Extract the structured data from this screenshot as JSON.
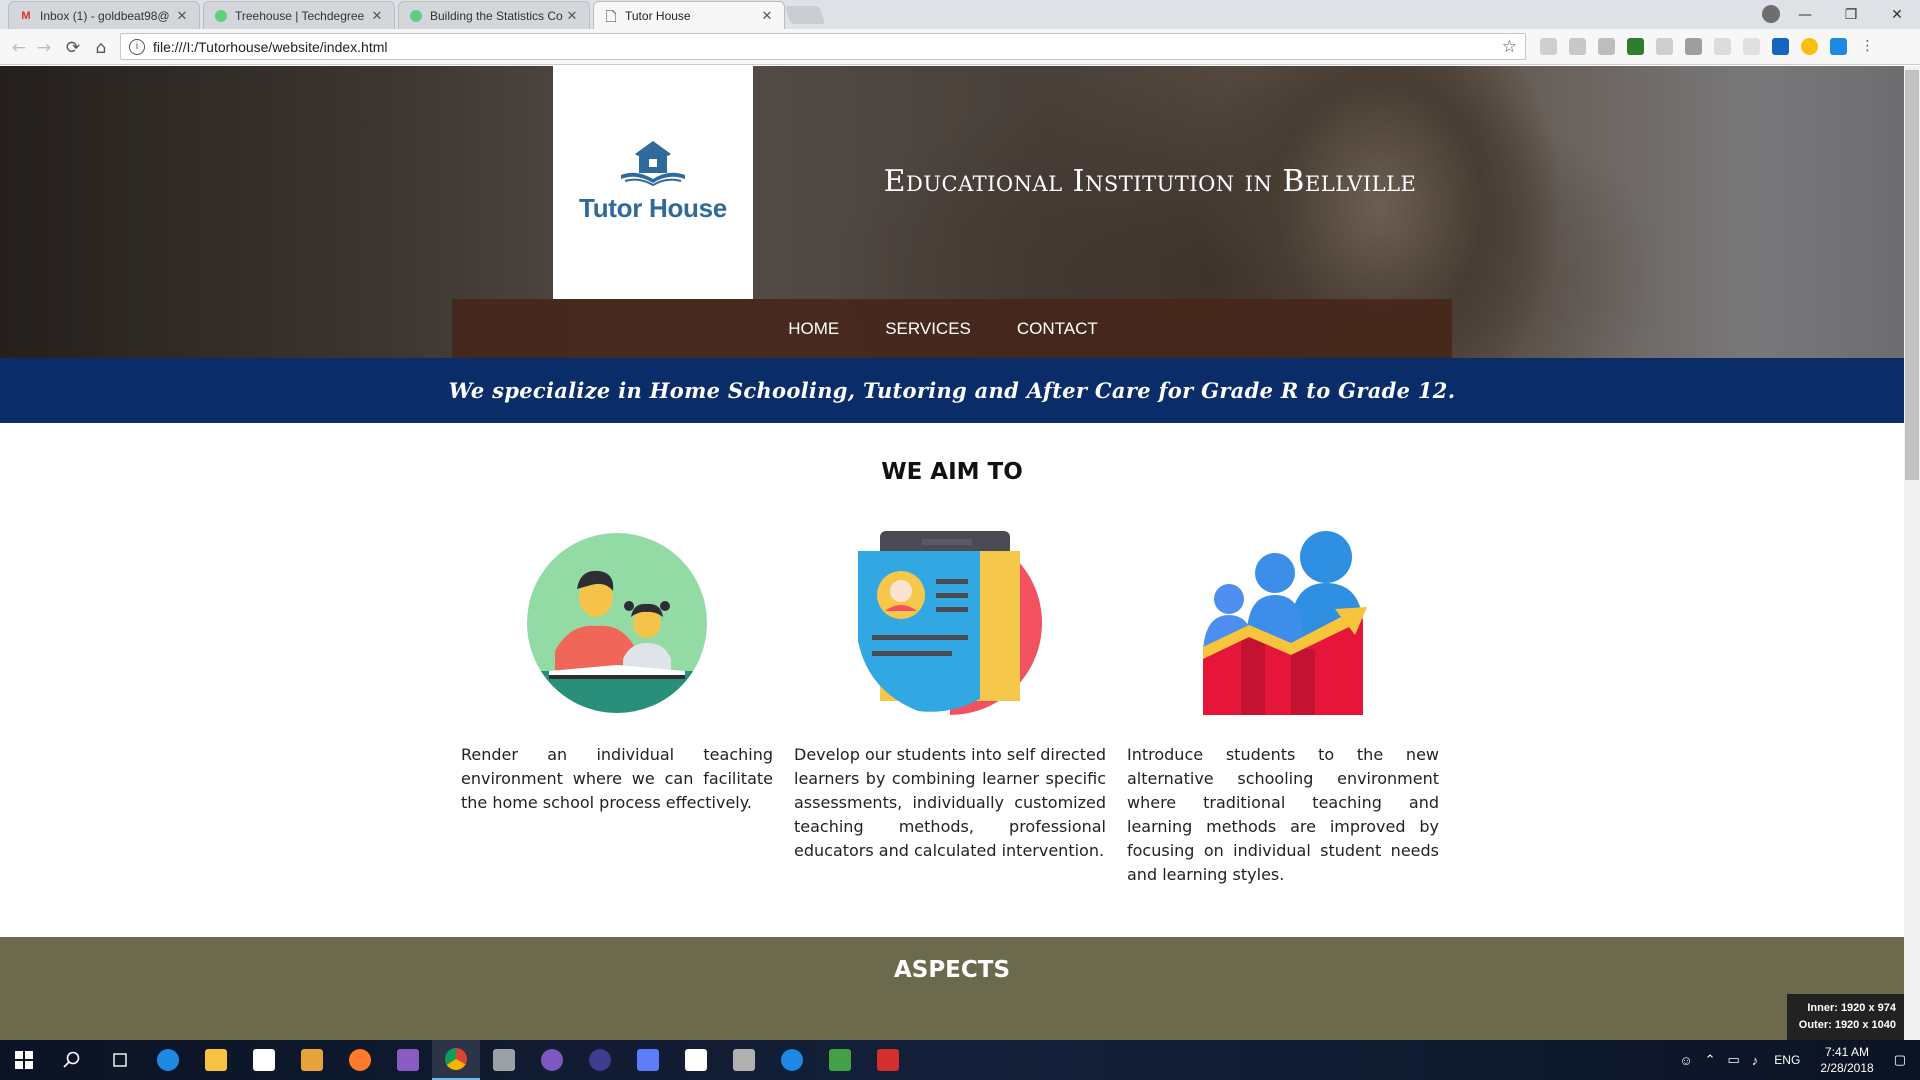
{
  "browser": {
    "tabs": [
      {
        "title": "Inbox (1) - goldbeat98@",
        "icon": "gmail-icon",
        "color": "#d93025"
      },
      {
        "title": "Treehouse | Techdegree",
        "icon": "treehouse-icon",
        "color": "#5fcf80"
      },
      {
        "title": "Building the Statistics Co",
        "icon": "treehouse-icon",
        "color": "#5fcf80"
      },
      {
        "title": "Tutor House",
        "icon": "page-icon",
        "color": "#666666"
      }
    ],
    "close_glyph": "✕",
    "url": "file:///I:/Tutorhouse/website/index.html",
    "back": "←",
    "forward": "→",
    "reload": "⟳",
    "home": "⌂",
    "star": "☆",
    "info": "i",
    "minimize": "—",
    "restore": "❐",
    "close": "✕"
  },
  "site": {
    "logo_text": "Tutor House",
    "tagline": "Educational Institution in Bellville",
    "nav": [
      "HOME",
      "SERVICES",
      "CONTACT"
    ],
    "banner": "We specialize in Home Schooling, Tutoring and After Care for Grade R to Grade 12.",
    "aim_heading": "WE AIM TO",
    "aims": [
      {
        "icon": "teacher-student-icon",
        "text": "Render an individual teaching environment where we can facilitate the home school process effectively."
      },
      {
        "icon": "student-profile-icon",
        "text": "Develop our students into self directed learners by combining learner specific assessments, individually customized teaching methods, professional educators and calculated intervention."
      },
      {
        "icon": "growth-chart-icon",
        "text": "Introduce students to the new alternative schooling environment where traditional teaching and learning methods are improved by focusing on individual student needs and learning styles."
      }
    ],
    "aspects_heading": "ASPECTS",
    "accent_colors": {
      "banner": "#0a2d6a",
      "aspects": "#6b6a4d",
      "logo": "#2f6a9a",
      "nav": "#46261a"
    }
  },
  "viewport_tip": {
    "inner": "Inner: 1920 x 974",
    "outer": "Outer: 1920 x 1040"
  },
  "taskbar": {
    "lang": "ENG",
    "time": "7:41 AM",
    "date": "2/28/2018"
  }
}
